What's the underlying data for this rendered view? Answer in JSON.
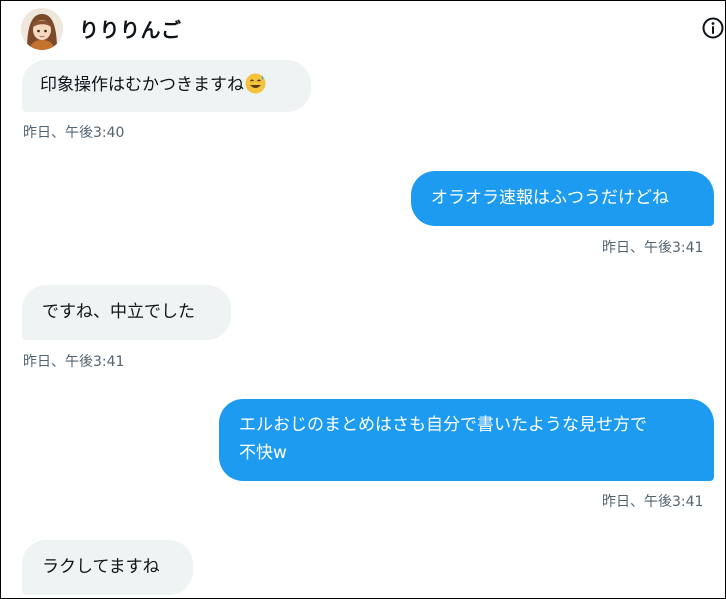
{
  "header": {
    "name": "りりりんご",
    "avatar_icon": "user-avatar",
    "info_icon": "info-icon"
  },
  "colors": {
    "incoming_bubble": "#eff3f4",
    "outgoing_bubble": "#1d9bf0",
    "timestamp": "#536471"
  },
  "messages": [
    {
      "direction": "in",
      "text": "印象操作はむかつきますね",
      "emoji": "grinning-sweat-emoji",
      "time": "昨日、午後3:40"
    },
    {
      "direction": "out",
      "text": "オラオラ速報はふつうだけどね",
      "time": "昨日、午後3:41"
    },
    {
      "direction": "in",
      "text": "ですね、中立でした",
      "time": "昨日、午後3:41"
    },
    {
      "direction": "out",
      "line1": "エルおじのまとめはさも自分で書いたような見せ方で",
      "line2": "不快w",
      "time": "昨日、午後3:41"
    },
    {
      "direction": "in",
      "text": "ラクしてますね"
    }
  ]
}
